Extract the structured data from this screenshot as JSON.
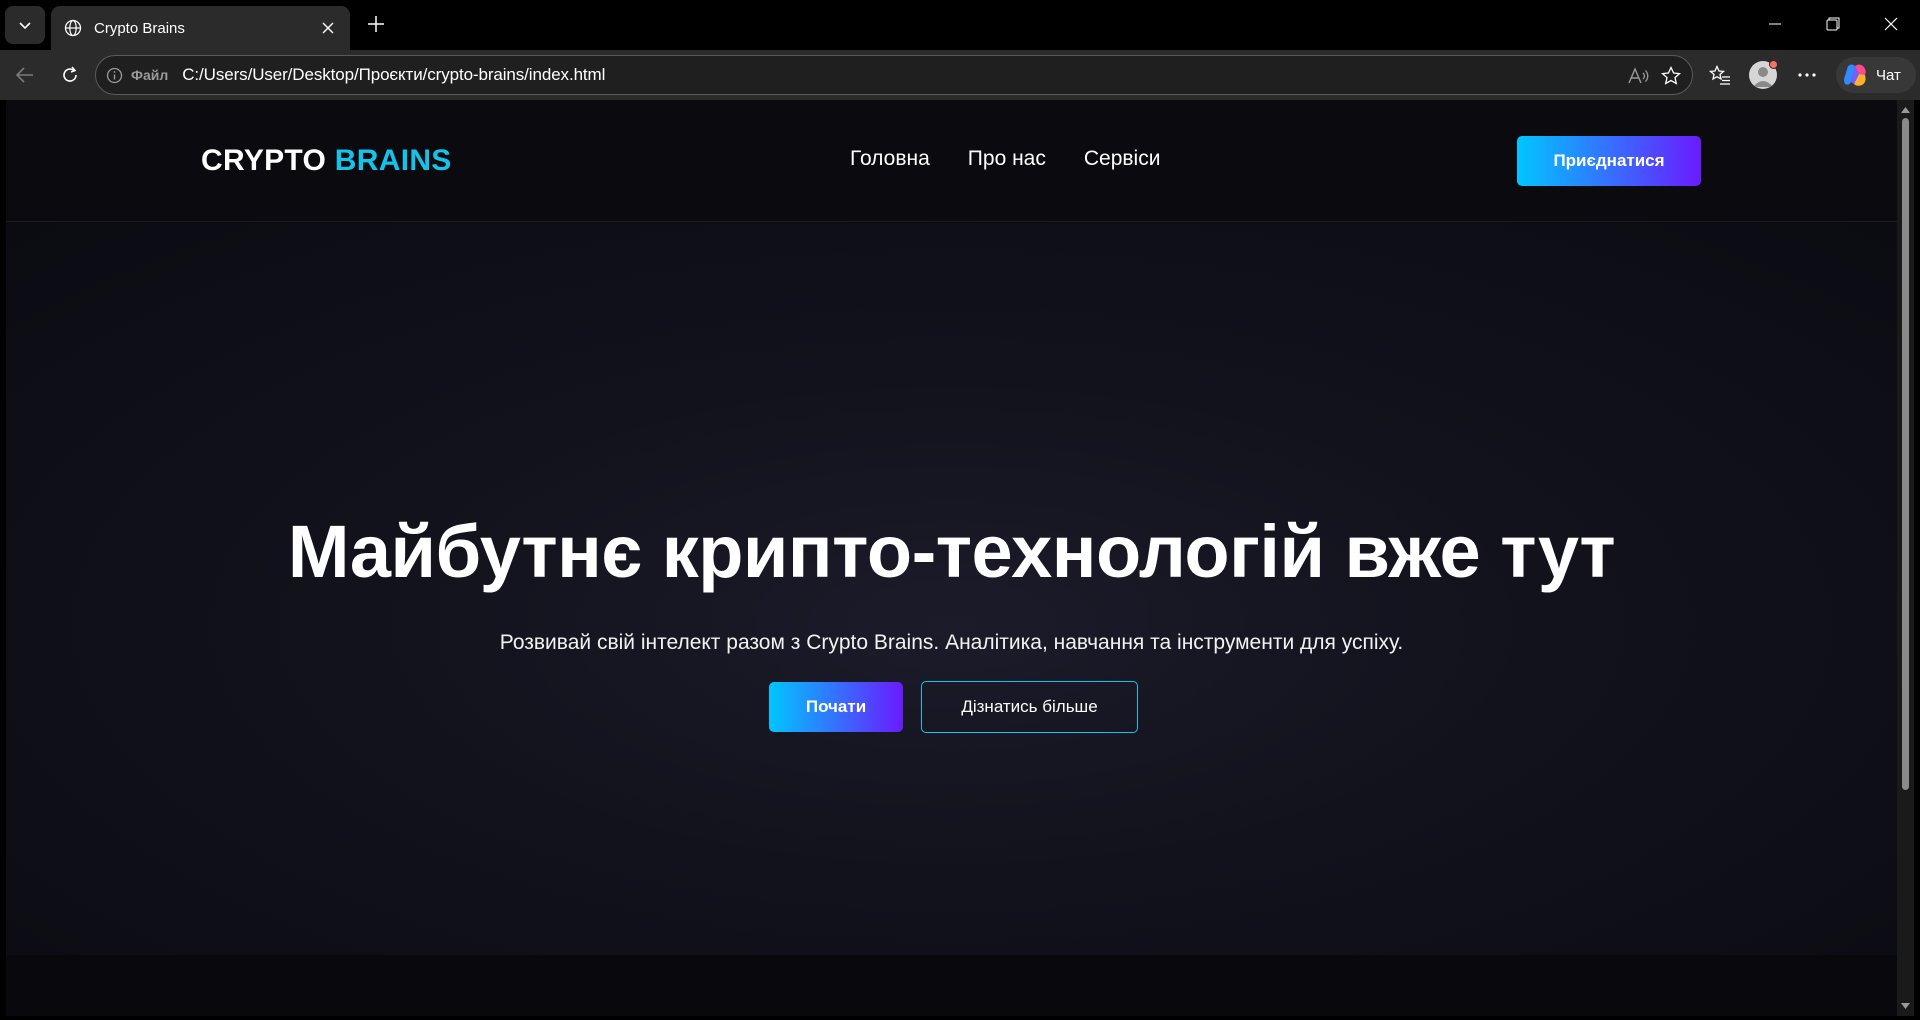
{
  "browser": {
    "tab_title": "Crypto Brains",
    "site_info_label": "Файл",
    "url": "C:/Users/User/Desktop/Проєкти/crypto-brains/index.html",
    "chat_label": "Чат",
    "icons": [
      "tab-list-icon",
      "globe-icon",
      "close-icon",
      "plus-icon",
      "minimize-icon",
      "restore-icon",
      "close-window-icon",
      "back-icon",
      "refresh-icon",
      "info-icon",
      "read-aloud-icon",
      "favorite-star-icon",
      "favorites-list-icon",
      "profile-icon",
      "more-icon",
      "copilot-icon"
    ]
  },
  "site": {
    "logo_primary": "CRYPTO",
    "logo_accent": "BRAINS",
    "nav": [
      "Головна",
      "Про нас",
      "Сервіси"
    ],
    "join_button": "Приєднатися",
    "hero_title": "Майбутнє крипто-технологій вже тут",
    "hero_subtitle": "Розвивай свій інтелект разом з Crypto Brains. Аналітика, навчання та інструменти для успіху.",
    "primary_button": "Почати",
    "secondary_button": "Дізнатись більше"
  },
  "colors": {
    "accent_cyan": "#14c3ea",
    "gradient_start": "#00c6ff",
    "gradient_end": "#6a1bff",
    "background": "#0a0a10"
  }
}
